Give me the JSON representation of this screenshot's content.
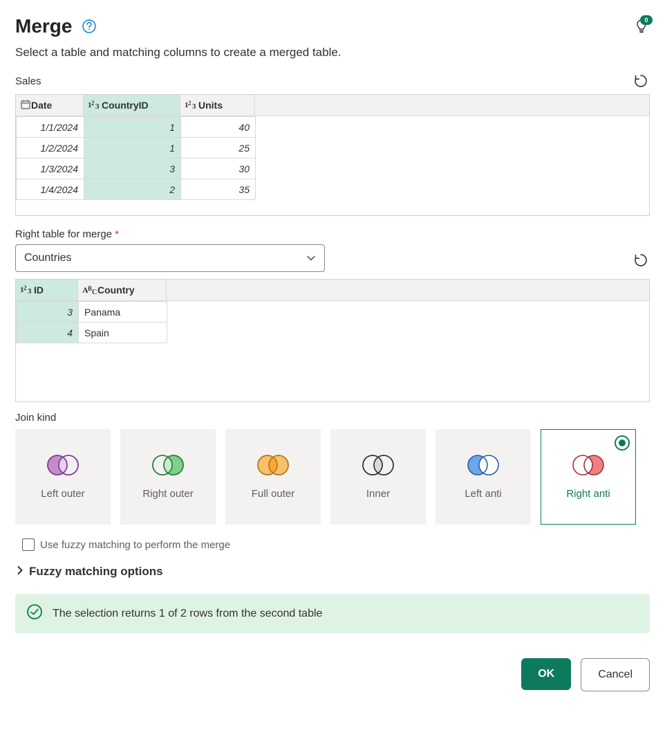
{
  "header": {
    "title": "Merge",
    "subtitle": "Select a table and matching columns to create a merged table.",
    "idea_badge": "0"
  },
  "left_table": {
    "name": "Sales",
    "columns": [
      {
        "name": "Date",
        "type": "date",
        "selected": false
      },
      {
        "name": "CountryID",
        "type": "number",
        "selected": true
      },
      {
        "name": "Units",
        "type": "number",
        "selected": false
      }
    ],
    "rows": [
      {
        "Date": "1/1/2024",
        "CountryID": "1",
        "Units": "40"
      },
      {
        "Date": "1/2/2024",
        "CountryID": "1",
        "Units": "25"
      },
      {
        "Date": "1/3/2024",
        "CountryID": "3",
        "Units": "30"
      },
      {
        "Date": "1/4/2024",
        "CountryID": "2",
        "Units": "35"
      }
    ]
  },
  "right_table": {
    "label": "Right table for merge",
    "selected": "Countries",
    "columns": [
      {
        "name": "ID",
        "type": "number",
        "selected": true
      },
      {
        "name": "Country",
        "type": "text",
        "selected": false
      }
    ],
    "rows": [
      {
        "ID": "3",
        "Country": "Panama"
      },
      {
        "ID": "4",
        "Country": "Spain"
      }
    ]
  },
  "joinkind": {
    "label": "Join kind",
    "options": [
      {
        "id": "left-outer",
        "label": "Left outer"
      },
      {
        "id": "right-outer",
        "label": "Right outer"
      },
      {
        "id": "full-outer",
        "label": "Full outer"
      },
      {
        "id": "inner",
        "label": "Inner"
      },
      {
        "id": "left-anti",
        "label": "Left anti"
      },
      {
        "id": "right-anti",
        "label": "Right anti"
      }
    ],
    "selected": "right-anti"
  },
  "fuzzy": {
    "checkbox_label": "Use fuzzy matching to perform the merge",
    "section_label": "Fuzzy matching options",
    "checked": false
  },
  "banner": {
    "text": "The selection returns 1 of 2 rows from the second table"
  },
  "buttons": {
    "ok": "OK",
    "cancel": "Cancel"
  }
}
